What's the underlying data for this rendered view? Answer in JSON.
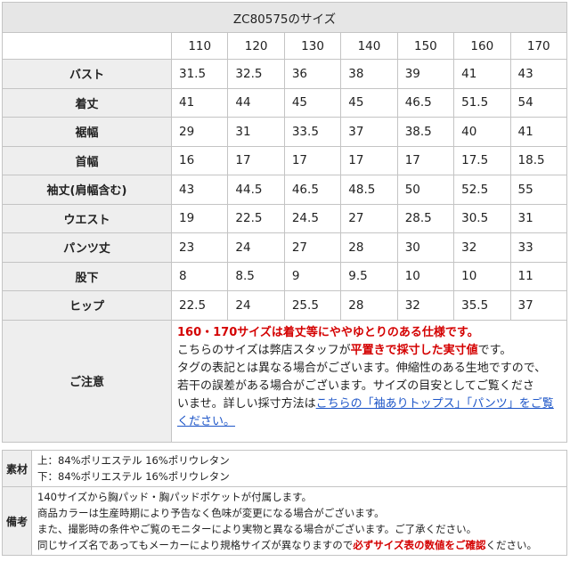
{
  "title": "ZC80575のサイズ",
  "sizes": [
    "110",
    "120",
    "130",
    "140",
    "150",
    "160",
    "170"
  ],
  "rows": [
    {
      "label": "バスト",
      "values": [
        "31.5",
        "32.5",
        "36",
        "38",
        "39",
        "41",
        "43"
      ]
    },
    {
      "label": "着丈",
      "values": [
        "41",
        "44",
        "45",
        "45",
        "46.5",
        "51.5",
        "54"
      ]
    },
    {
      "label": "裾幅",
      "values": [
        "29",
        "31",
        "33.5",
        "37",
        "38.5",
        "40",
        "41"
      ]
    },
    {
      "label": "首幅",
      "values": [
        "16",
        "17",
        "17",
        "17",
        "17",
        "17.5",
        "18.5"
      ]
    },
    {
      "label": "袖丈(肩幅含む)",
      "values": [
        "43",
        "44.5",
        "46.5",
        "48.5",
        "50",
        "52.5",
        "55"
      ]
    },
    {
      "label": "ウエスト",
      "values": [
        "19",
        "22.5",
        "24.5",
        "27",
        "28.5",
        "30.5",
        "31"
      ]
    },
    {
      "label": "パンツ丈",
      "values": [
        "23",
        "24",
        "27",
        "28",
        "30",
        "32",
        "33"
      ]
    },
    {
      "label": "股下",
      "values": [
        "8",
        "8.5",
        "9",
        "9.5",
        "10",
        "10",
        "11"
      ]
    },
    {
      "label": "ヒップ",
      "values": [
        "22.5",
        "24",
        "25.5",
        "28",
        "32",
        "35.5",
        "37"
      ]
    }
  ],
  "notes": {
    "label": "ご注意",
    "line1": "160・170サイズは着丈等にややゆとりのある仕様です。",
    "line2_a": "こちらのサイズは弊店スタッフが",
    "line2_b": "平置きで採寸した実寸値",
    "line2_c": "です。",
    "line3": "タグの表記とは異なる場合がございます。伸縮性のある生地ですので、",
    "line4": "若干の誤差がある場合がございます。サイズの目安としてご覧くださ",
    "line5_a": "いませ。詳しい採寸方法は",
    "line5_link": "こちらの「袖ありトップス」「パンツ」をご覧ください。"
  },
  "material": {
    "label": "素材",
    "line1": "上：84%ポリエステル 16%ポリウレタン",
    "line2": "下：84%ポリエステル 16%ポリウレタン"
  },
  "remarks": {
    "label": "備考",
    "line1": "140サイズから胸パッド・胸パッドポケットが付属します。",
    "line2": "商品カラーは生産時期により予告なく色味が変更になる場合がございます。",
    "line3": "また、撮影時の条件やご覧のモニターにより実物と異なる場合がございます。ご了承ください。",
    "line4_a": "同じサイズ名であってもメーカーにより規格サイズが異なりますので",
    "line4_b": "必ずサイズ表の数値をご確認",
    "line4_c": "ください。"
  }
}
